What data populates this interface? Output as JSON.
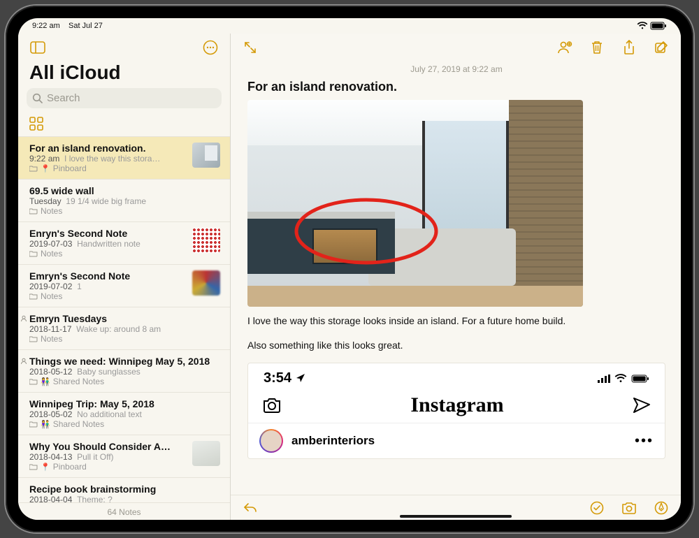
{
  "statusbar": {
    "time": "9:22 am",
    "date": "Sat Jul 27"
  },
  "sidebar": {
    "title": "All iCloud",
    "search_placeholder": "Search",
    "footer": "64 Notes",
    "items": [
      {
        "title": "For an island renovation.",
        "time": "9:22 am",
        "preview": "I love the way this stora…",
        "folder": "Pinboard",
        "pinned": true,
        "thumb": "room",
        "selected": true
      },
      {
        "title": "69.5 wide wall",
        "time": "Tuesday",
        "preview": "19 1/4 wide big frame",
        "folder": "Notes"
      },
      {
        "title": "Enryn's Second Note",
        "time": "2019-07-03",
        "preview": "Handwritten note",
        "folder": "Notes",
        "thumb": "scribble1"
      },
      {
        "title": "Emryn's Second Note",
        "time": "2019-07-02",
        "preview": "1",
        "folder": "Notes",
        "thumb": "scribble2"
      },
      {
        "title": "Emryn Tuesdays",
        "time": "2018-11-17",
        "preview": "Wake up: around 8 am",
        "folder": "Notes",
        "shared": true
      },
      {
        "title": "Things we need: Winnipeg May 5, 2018",
        "time": "2018-05-12",
        "preview": "Baby sunglasses",
        "folder": "Shared Notes",
        "shared": true,
        "people": true
      },
      {
        "title": "Winnipeg Trip: May 5, 2018",
        "time": "2018-05-02",
        "preview": "No additional text",
        "folder": "Shared Notes",
        "people": true
      },
      {
        "title": "Why You Should Consider A…",
        "time": "2018-04-13",
        "preview": "Pull it Off)",
        "folder": "Pinboard",
        "pinned": true,
        "thumb": "room2"
      },
      {
        "title": "Recipe book brainstorming",
        "time": "2018-04-04",
        "preview": "Theme: ?",
        "folder": ""
      }
    ]
  },
  "note": {
    "date": "July 27, 2019 at 9:22 am",
    "title": "For an island renovation.",
    "body1": "I love the way this storage looks inside an island. For a future home build.",
    "body2": "Also something like this looks great.",
    "instagram": {
      "clock": "3:54",
      "logo": "Instagram",
      "username": "amberinteriors",
      "more": "•••"
    }
  },
  "labels": {
    "folder_icon": "📁"
  }
}
